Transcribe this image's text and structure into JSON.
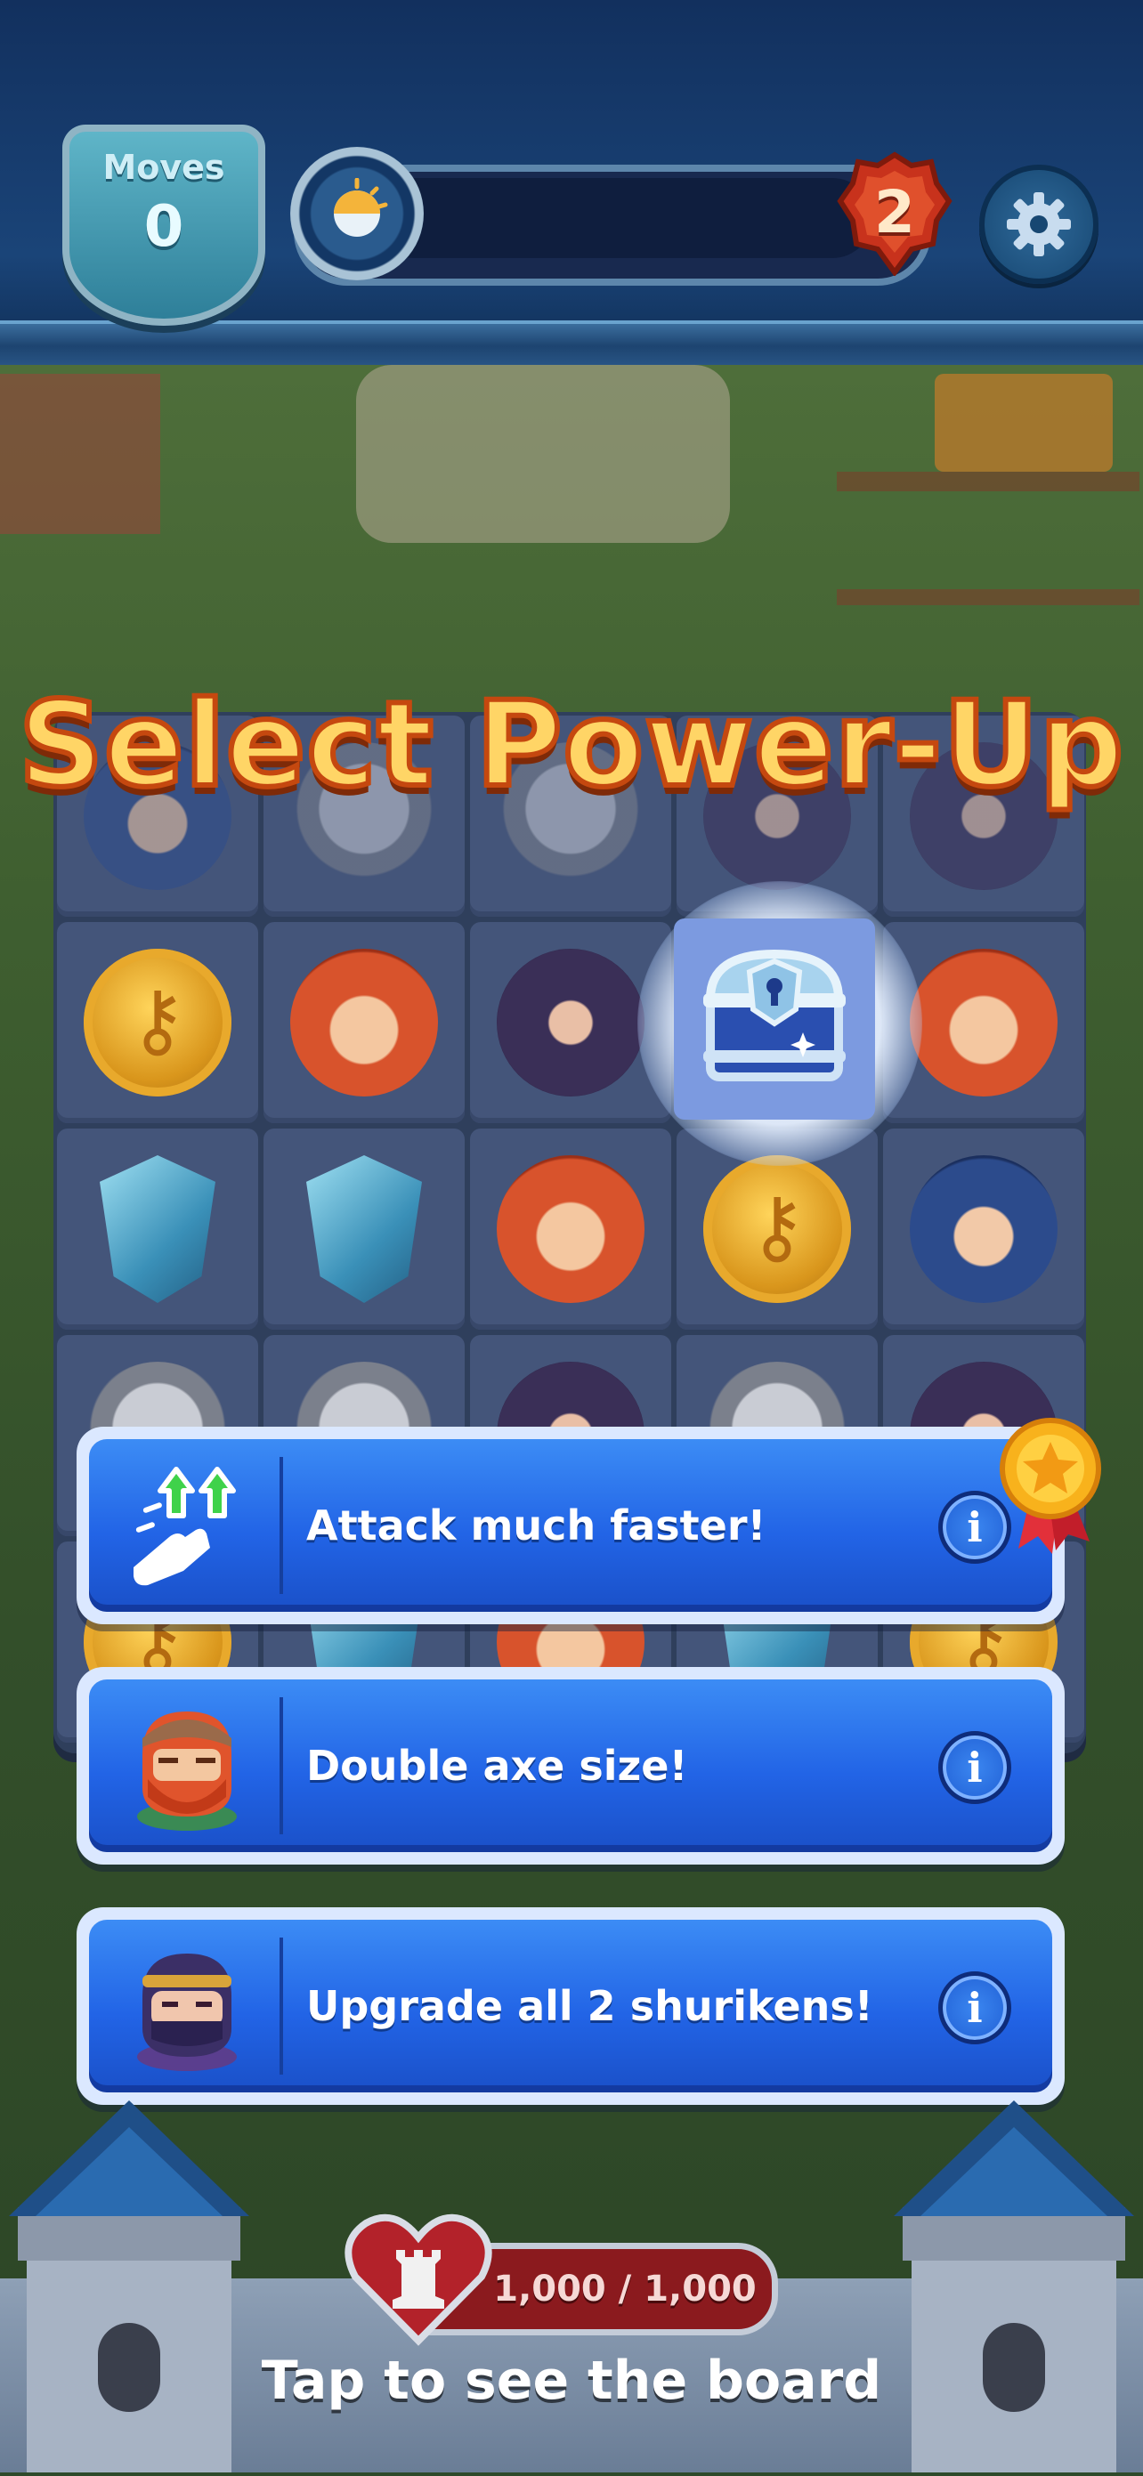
{
  "hud": {
    "moves_label": "Moves",
    "moves_value": "0",
    "level_number": "2",
    "icons": [
      "day-night-icon",
      "level-shield-icon",
      "gear-icon"
    ]
  },
  "title": "Select Power-Up",
  "board": {
    "highlighted_piece": "treasure-chest-icon"
  },
  "powerups": [
    {
      "label": "Attack much faster!",
      "icon": "speed-tap-icon",
      "info": "i",
      "featured": true
    },
    {
      "label": "Double axe size!",
      "icon": "viking-icon",
      "info": "i"
    },
    {
      "label": "Upgrade all 2 shurikens!",
      "icon": "ninja-icon",
      "info": "i"
    }
  ],
  "castle": {
    "health": "1,000 / 1,000"
  },
  "hint": "Tap to see the board",
  "colors": {
    "card_blue": "#2264e6",
    "title_gold": "#ffd566",
    "title_outline": "#c5480f",
    "health_red": "#8b1a1e"
  }
}
